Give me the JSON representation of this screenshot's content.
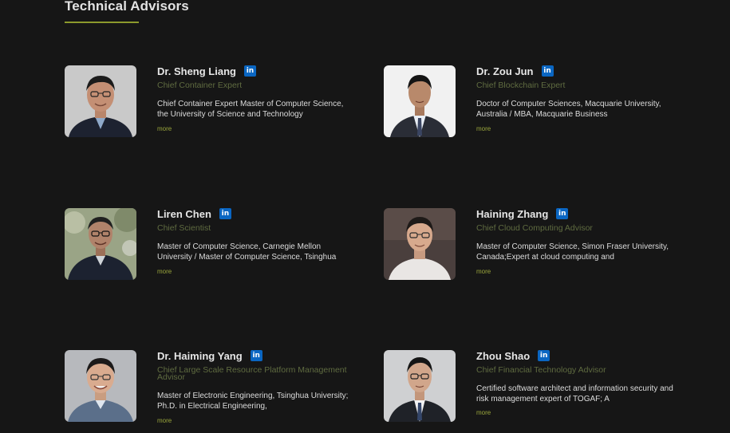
{
  "section": {
    "title": "Technical Advisors"
  },
  "linkedin_label": "in",
  "advisors": [
    {
      "name": "Dr. Sheng Liang",
      "role": "Chief Container Expert",
      "description": "Chief Container Expert Master of Computer Science, the University of Science and Technology",
      "more_label": "more"
    },
    {
      "name": "Dr. Zou Jun",
      "role": "Chief Blockchain Expert",
      "description": "Doctor of Computer Sciences, Macquarie University, Australia / MBA, Macquarie Business",
      "more_label": "more"
    },
    {
      "name": "Liren Chen",
      "role": "Chief Scientist",
      "description": "Master of Computer Science, Carnegie Mellon University / Master of Computer Science, Tsinghua",
      "more_label": "more"
    },
    {
      "name": "Haining Zhang",
      "role": "Chief Cloud Computing Advisor",
      "description": "Master of Computer Science, Simon Fraser University, Canada;Expert at cloud computing and",
      "more_label": "more"
    },
    {
      "name": "Dr. Haiming Yang",
      "role": "Chief Large Scale Resource Platform Management Advisor",
      "description": "Master of Electronic Engineering, Tsinghua University; Ph.D. in Electrical Engineering,",
      "more_label": "more"
    },
    {
      "name": "Zhou Shao",
      "role": "Chief Financial Technology Advisor",
      "description": "Certified software architect and information security and risk management expert of TOGAF; A",
      "more_label": "more"
    }
  ],
  "colors": {
    "background": "#161616",
    "accent": "#8c9a2c",
    "role_text": "#5f6b40",
    "linkedin": "#0a66c2"
  }
}
